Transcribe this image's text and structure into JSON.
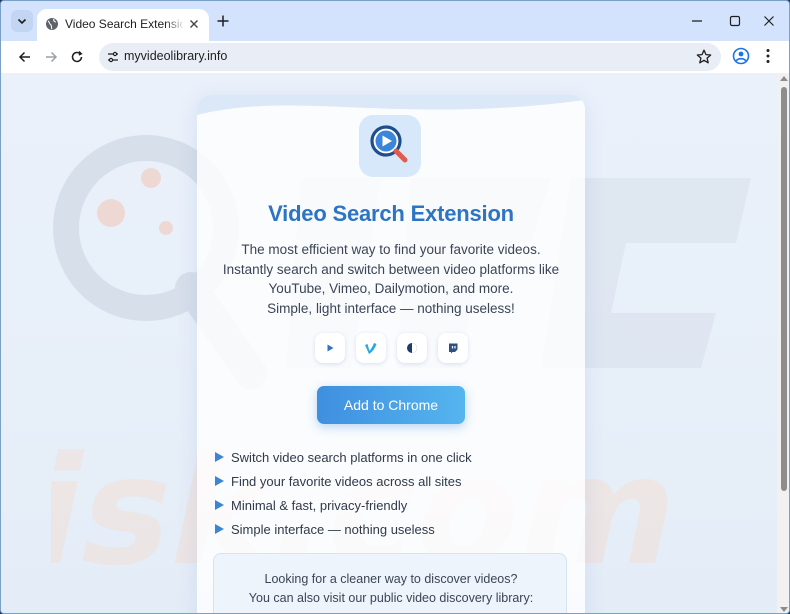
{
  "browser": {
    "tab": {
      "title": "Video Search Extension – Find Y"
    },
    "address": {
      "url": "myvideolibrary.info"
    }
  },
  "page": {
    "title": "Video Search Extension",
    "description": [
      "The most efficient way to find your favorite videos.",
      "Instantly search and switch between video platforms like",
      "YouTube, Vimeo, Dailymotion, and more.",
      "Simple, light interface — nothing useless!"
    ],
    "platform_icons": [
      "youtube-icon",
      "vimeo-icon",
      "dailymotion-icon",
      "twitch-icon"
    ],
    "cta_label": "Add to Chrome",
    "features": [
      "Switch video search platforms in one click",
      "Find your favorite videos across all sites",
      "Minimal & fast, privacy-friendly",
      "Simple interface — nothing useless"
    ],
    "info": [
      "Looking for a cleaner way to discover videos?",
      "You can also visit our public video discovery library:"
    ]
  },
  "colors": {
    "accent": "#2d74c4",
    "cta_start": "#3f8fe0",
    "cta_end": "#55b5ee",
    "tabstrip": "#d3e3fd"
  }
}
